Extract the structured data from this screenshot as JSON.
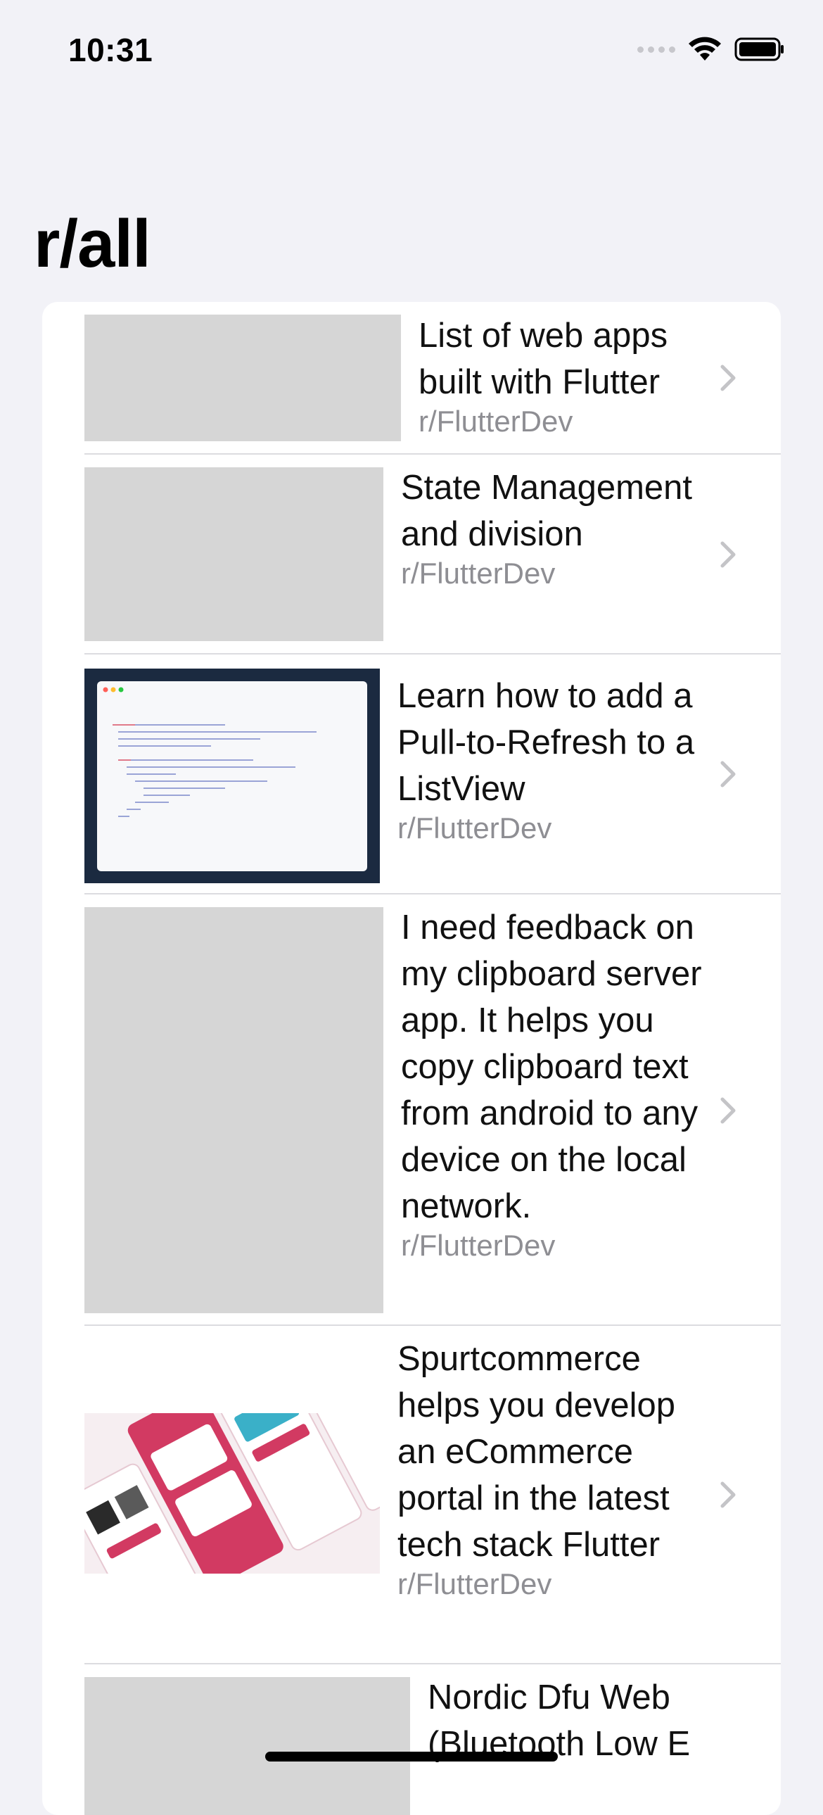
{
  "status_bar": {
    "time": "10:31"
  },
  "header": {
    "title": "r/all"
  },
  "posts": [
    {
      "title": "List of web apps built with Flutter",
      "subreddit": "r/FlutterDev",
      "thumbnail": "placeholder"
    },
    {
      "title": "State Management and division",
      "subreddit": "r/FlutterDev",
      "thumbnail": "placeholder"
    },
    {
      "title": "Learn how to add a Pull-to-Refresh to a ListView",
      "subreddit": "r/FlutterDev",
      "thumbnail": "code-screenshot-image"
    },
    {
      "title": "I need feedback on my clipboard server app. It helps you copy clipboard text from android to any device on the local network.",
      "subreddit": "r/FlutterDev",
      "thumbnail": "placeholder"
    },
    {
      "title": "Spurtcommerce helps you develop an eCommerce portal in the latest tech stack Flutter",
      "subreddit": "r/FlutterDev",
      "thumbnail": "ecommerce-mockup-image"
    },
    {
      "title": "Nordic Dfu Web (Bluetooth Low E",
      "subreddit": "",
      "thumbnail": "placeholder"
    }
  ],
  "icons": {
    "chevron": "chevron-right-icon",
    "wifi": "wifi-icon",
    "battery": "battery-icon",
    "signal": "cellular-signal-icon"
  },
  "colors": {
    "background": "#f2f2f7",
    "card": "#ffffff",
    "placeholder": "#d6d6d6",
    "secondary_text": "#8e8e93",
    "chevron": "#c4c4c7"
  }
}
